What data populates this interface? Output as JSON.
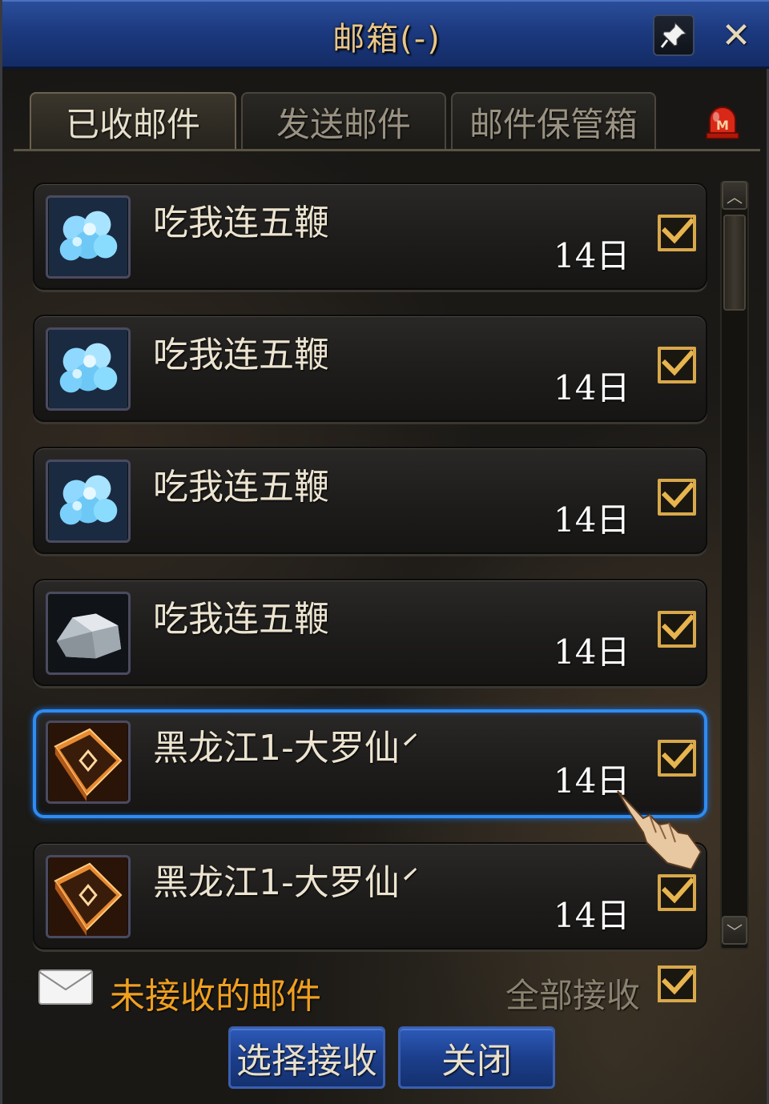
{
  "window": {
    "title": "邮箱(-)"
  },
  "tabs": [
    {
      "label": "已收邮件",
      "active": true
    },
    {
      "label": "发送邮件",
      "active": false
    },
    {
      "label": "邮件保管箱",
      "active": false
    }
  ],
  "mails": [
    {
      "sender": "吃我连五鞭",
      "date": "14日",
      "icon": "blue-crystal-icon",
      "checked": true,
      "selected": false
    },
    {
      "sender": "吃我连五鞭",
      "date": "14日",
      "icon": "blue-crystal-icon",
      "checked": true,
      "selected": false
    },
    {
      "sender": "吃我连五鞭",
      "date": "14日",
      "icon": "blue-crystal-icon",
      "checked": true,
      "selected": false
    },
    {
      "sender": "吃我连五鞭",
      "date": "14日",
      "icon": "silver-ore-icon",
      "checked": true,
      "selected": false
    },
    {
      "sender": "黑龙江1-大罗仙́",
      "date": "14日",
      "icon": "spellbook-icon",
      "checked": true,
      "selected": true
    },
    {
      "sender": "黑龙江1-大罗仙́",
      "date": "14日",
      "icon": "spellbook-icon",
      "checked": true,
      "selected": false
    }
  ],
  "footer": {
    "unread_label": "未接收的邮件",
    "receive_all_label": "全部接收",
    "receive_all_checked": true,
    "select_receive_button": "选择接收",
    "close_button": "关闭"
  },
  "colors": {
    "title_bar": "#1c3a80",
    "selection_border": "#2f8cf0",
    "checkbox_gold": "#d8a84a",
    "unread_orange": "#f0a020",
    "button_blue": "#1c3f8c"
  }
}
